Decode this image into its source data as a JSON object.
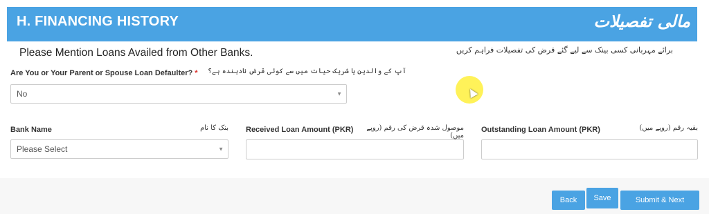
{
  "header": {
    "title": "H. FINANCING HISTORY",
    "urdu_title": "مالی تفصیلات"
  },
  "intro": {
    "text": "Please Mention Loans Availed from Other Banks.",
    "urdu": "برائے مہربانی کسی بینک سے لیے گئے قرض کی تفصیلات فراہم کریں"
  },
  "defaulter": {
    "label": "Are You or Your Parent or Spouse Loan Defaulter?",
    "required_mark": "*",
    "urdu": "آپ کے والدین یا شریک حیات میں سے کوئی قرض نادہندہ ہے؟",
    "value": "No"
  },
  "bank_name": {
    "label": "Bank Name",
    "urdu": "بنک کا نام",
    "value": "Please Select"
  },
  "received_loan": {
    "label": "Received Loan Amount (PKR)",
    "urdu": "موصول شدہ قرض کی رقم (روپے میں)",
    "value": ""
  },
  "outstanding_loan": {
    "label": "Outstanding Loan Amount (PKR)",
    "urdu": "بقیہ رقم (روپے میں)",
    "value": ""
  },
  "buttons": {
    "back": "Back",
    "save": "Save",
    "submit": "Submit & Next"
  },
  "colors": {
    "accent": "#4aa3e3",
    "required": "#d9302b"
  }
}
